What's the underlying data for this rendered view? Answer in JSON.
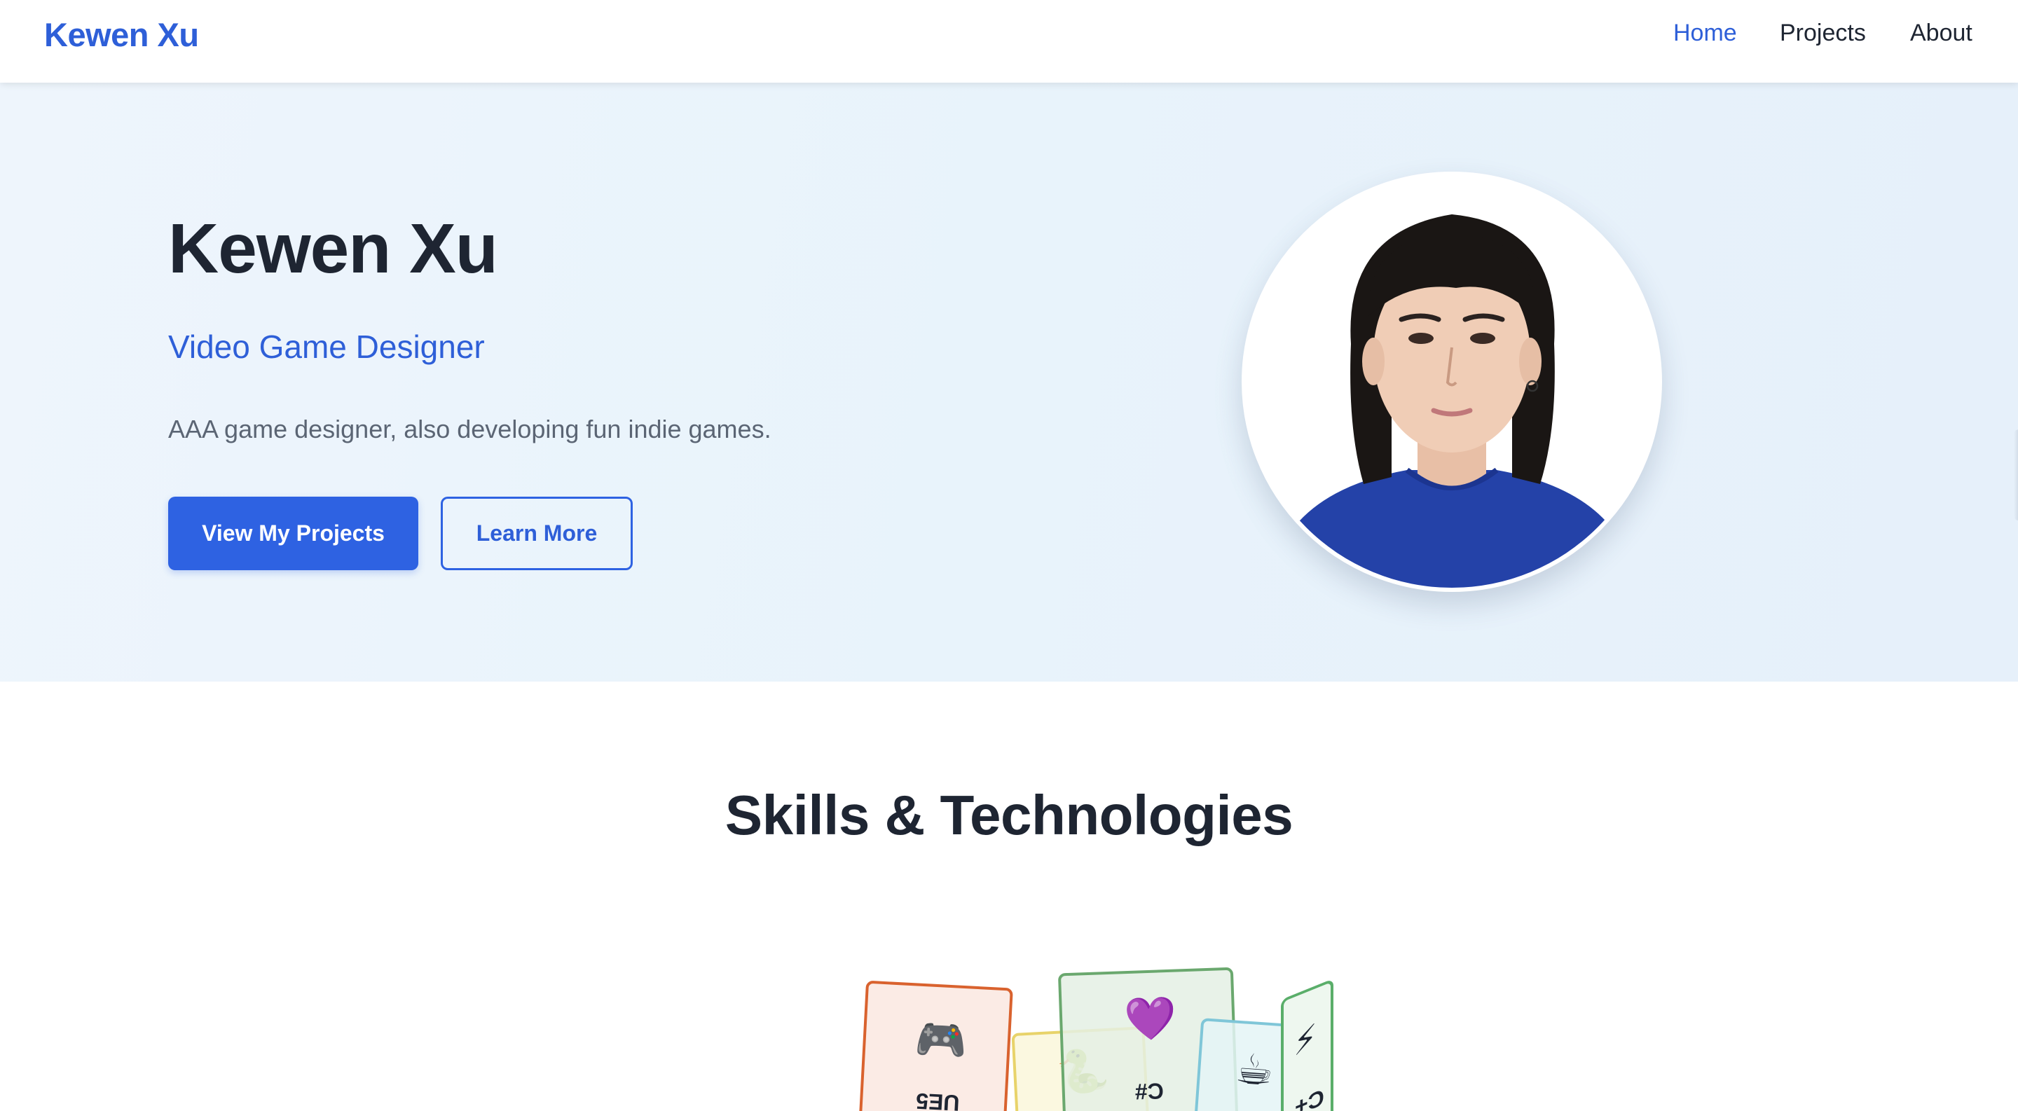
{
  "navbar": {
    "brand": "Kewen Xu",
    "links": [
      {
        "label": "Home",
        "active": true
      },
      {
        "label": "Projects",
        "active": false
      },
      {
        "label": "About",
        "active": false
      }
    ]
  },
  "hero": {
    "title": "Kewen Xu",
    "subtitle": "Video Game Designer",
    "description": "AAA game designer, also developing fun indie games.",
    "primary_button": "View My Projects",
    "secondary_button": "Learn More"
  },
  "skills": {
    "title": "Skills & Technologies",
    "cards": [
      {
        "icon": "game-controller-icon",
        "emoji": "🎮",
        "label": "UE5",
        "color": "#d9622e"
      },
      {
        "icon": "python-snake-icon",
        "emoji": "🐍",
        "label": "",
        "color": "#e8d36a"
      },
      {
        "icon": "purple-heart-icon",
        "emoji": "💜",
        "label": "C#",
        "color": "#6aa86e"
      },
      {
        "icon": "coffee-icon",
        "emoji": "☕",
        "label": "",
        "color": "#7fc6d8"
      },
      {
        "icon": "lightning-icon",
        "emoji": "⚡",
        "label": "C+",
        "color": "#5aae6a"
      }
    ]
  },
  "colors": {
    "accent": "#2e5fd8",
    "text_dark": "#1e2532",
    "text_muted": "#5b6574",
    "hero_bg": "#eaf3fb",
    "shirt_blue": "#2442a8"
  }
}
